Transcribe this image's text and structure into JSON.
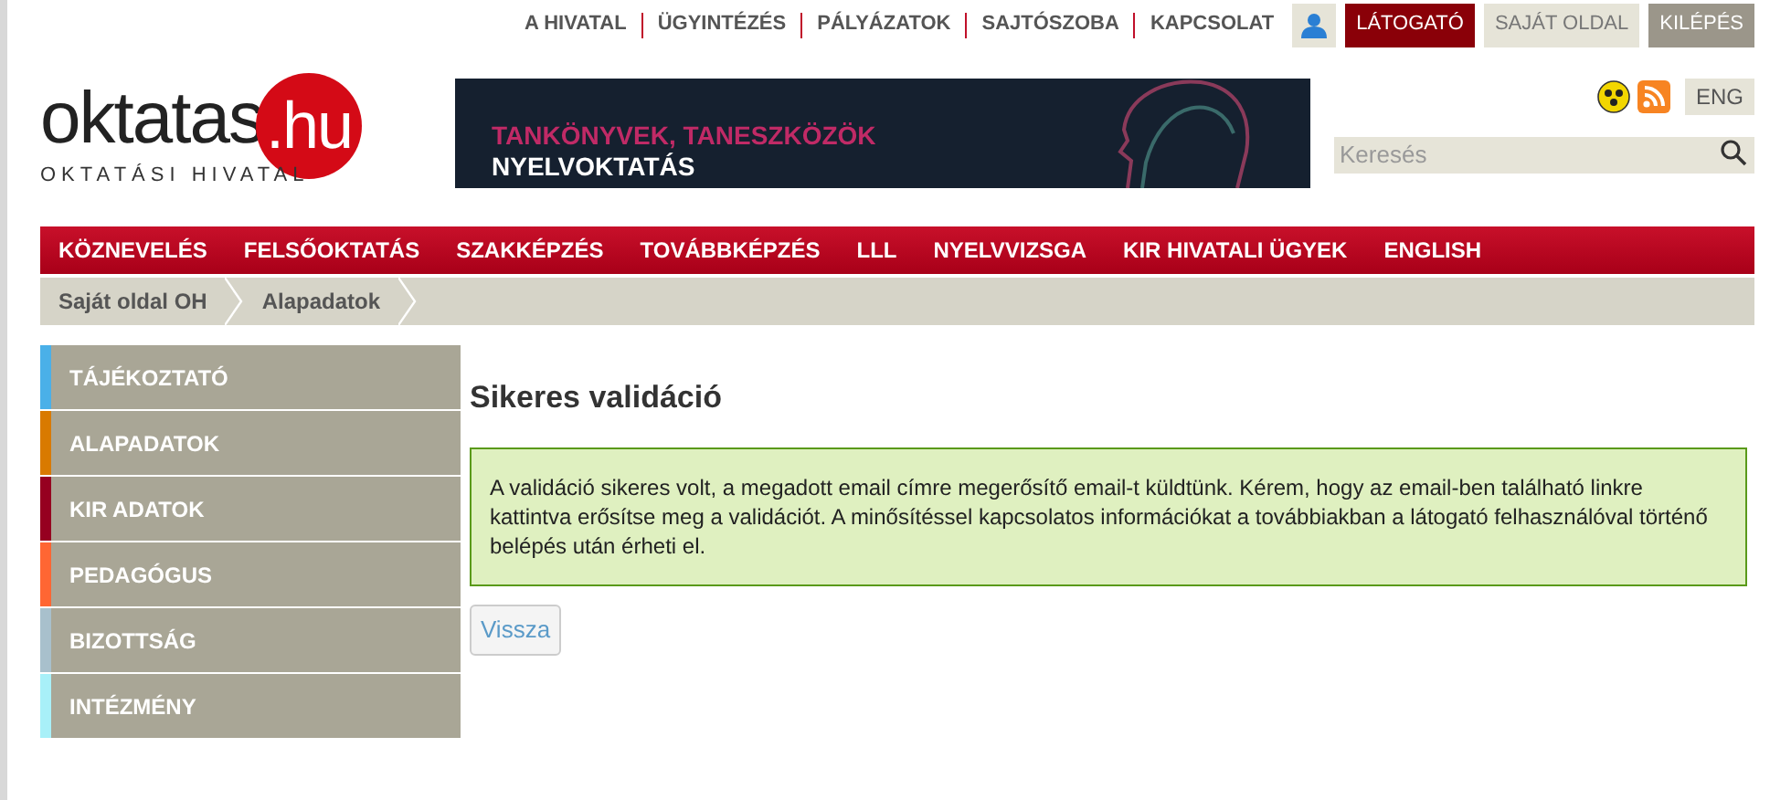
{
  "top_links": [
    "A HIVATAL",
    "ÜGYINTÉZÉS",
    "PÁLYÁZATOK",
    "SAJTÓSZOBA",
    "KAPCSOLAT"
  ],
  "account_buttons": [
    {
      "label": "LÁTOGATÓ",
      "kind": "visitor"
    },
    {
      "label": "SAJÁT OLDAL",
      "kind": "light"
    },
    {
      "label": "KILÉPÉS",
      "kind": "dark"
    }
  ],
  "logo": {
    "name": "oktatas",
    "tld": ".hu",
    "subtitle": "OKTATÁSI HIVATAL"
  },
  "banner": {
    "line_1": "TANKÖNYVEK, TANESZKÖZÖK",
    "line_2": "NYELVOKTATÁS"
  },
  "language_button": "ENG",
  "search": {
    "placeholder": "Keresés"
  },
  "main_nav": [
    "KÖZNEVELÉS",
    "FELSŐOKTATÁS",
    "SZAKKÉPZÉS",
    "TOVÁBBKÉPZÉS",
    "LLL",
    "NYELVVIZSGA",
    "KIR HIVATALI ÜGYEK",
    "ENGLISH"
  ],
  "breadcrumb": [
    "Saját oldal OH",
    "Alapadatok"
  ],
  "sidebar": {
    "items": [
      {
        "label": "TÁJÉKOZTATÓ",
        "color": "#4ab0e8"
      },
      {
        "label": "ALAPADATOK",
        "color": "#d97a00"
      },
      {
        "label": "KIR ADATOK",
        "color": "#960020"
      },
      {
        "label": "PEDAGÓGUS",
        "color": "#ff6633"
      },
      {
        "label": "BIZOTTSÁG",
        "color": "#a8c0cc"
      },
      {
        "label": "INTÉZMÉNY",
        "color": "#a8f0f8"
      }
    ]
  },
  "content": {
    "title": "Sikeres validáció",
    "message": "A validáció sikeres volt, a megadott email címre megerősítő email-t küldtünk. Kérem, hogy az email-ben található linkre kattintva erősítse meg a validációt. A minősítéssel kapcsolatos információkat a továbbiakban a látogató felhasználóval történő belépés után érheti el.",
    "back_button": "Vissza"
  }
}
